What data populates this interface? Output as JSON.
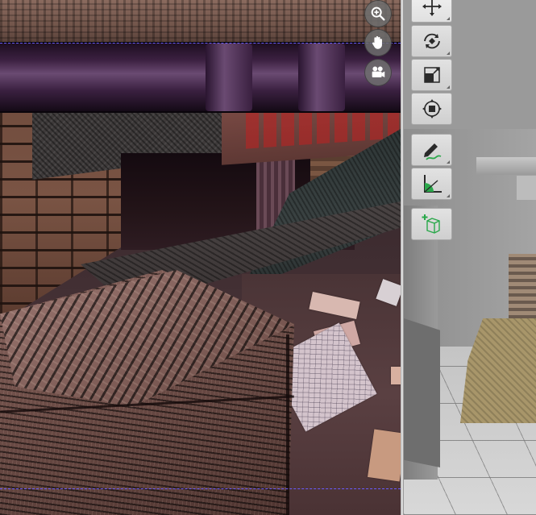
{
  "app": {
    "colors": {
      "guide_line": "#6a5cff",
      "toolbar_bg": "#d8d8d8",
      "nav_button_bg": "#6e6e6e",
      "icon_green": "#2aa84a",
      "icon_dark": "#2a2a2a"
    }
  },
  "viewport_left": {
    "nav_buttons": [
      {
        "icon": "zoom-icon"
      },
      {
        "icon": "pan-hand-icon"
      },
      {
        "icon": "camera-icon"
      }
    ]
  },
  "toolbar": {
    "buttons": [
      {
        "icon": "move-arrows-icon"
      },
      {
        "icon": "rotate-icon"
      },
      {
        "icon": "scale-icon"
      },
      {
        "icon": "transform-gizmo-icon"
      },
      {
        "icon": "pencil-draw-icon"
      },
      {
        "icon": "measure-angle-icon"
      },
      {
        "icon": "add-cube-icon"
      }
    ]
  }
}
